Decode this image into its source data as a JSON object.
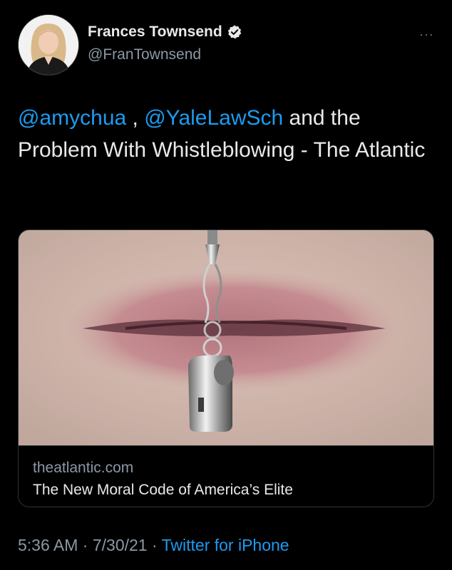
{
  "author": {
    "display_name": "Frances Townsend",
    "handle": "@FranTownsend",
    "verified_icon": "verified-badge-icon",
    "avatar_icon": "profile-photo"
  },
  "more_icon": "···",
  "tweet": {
    "mention1": "@amychua",
    "sep": " , ",
    "mention2": "@YaleLawSch",
    "text_rest": " and the Problem With Whistleblowing - The Atlantic"
  },
  "link_card": {
    "image_icon": "whistle-between-lips-image",
    "domain": "theatlantic.com",
    "title": "The New Moral Code of America’s Elite"
  },
  "meta": {
    "time": "5:36 AM",
    "dot1": " · ",
    "date": "7/30/21",
    "dot2": " · ",
    "source": "Twitter for iPhone"
  },
  "colors": {
    "background": "#000000",
    "link_blue": "#1d9bf0",
    "secondary_text": "#8b98a5",
    "primary_text": "#e7e9ea"
  }
}
